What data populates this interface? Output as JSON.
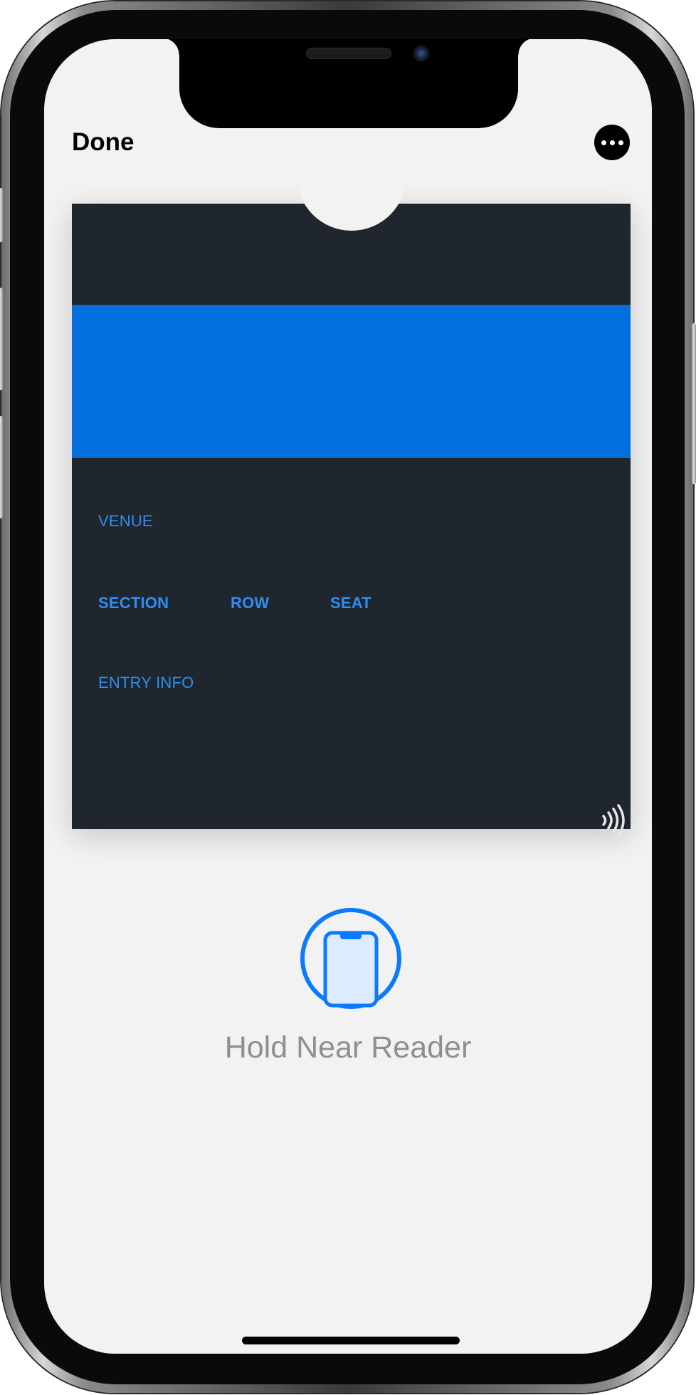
{
  "header": {
    "done_label": "Done",
    "more_icon": "ellipsis-icon"
  },
  "pass": {
    "background_color": "#20262e",
    "band_color": "#036ede",
    "label_color": "#2f8ef0",
    "fields": {
      "venue": "VENUE",
      "section": "SECTION",
      "row": "ROW",
      "seat": "SEAT",
      "entry_info": "ENTRY INFO"
    },
    "contactless_icon": "contactless-icon"
  },
  "reader": {
    "icon": "phone-in-circle-icon",
    "text": "Hold Near Reader",
    "accent_color": "#0a7aff"
  }
}
